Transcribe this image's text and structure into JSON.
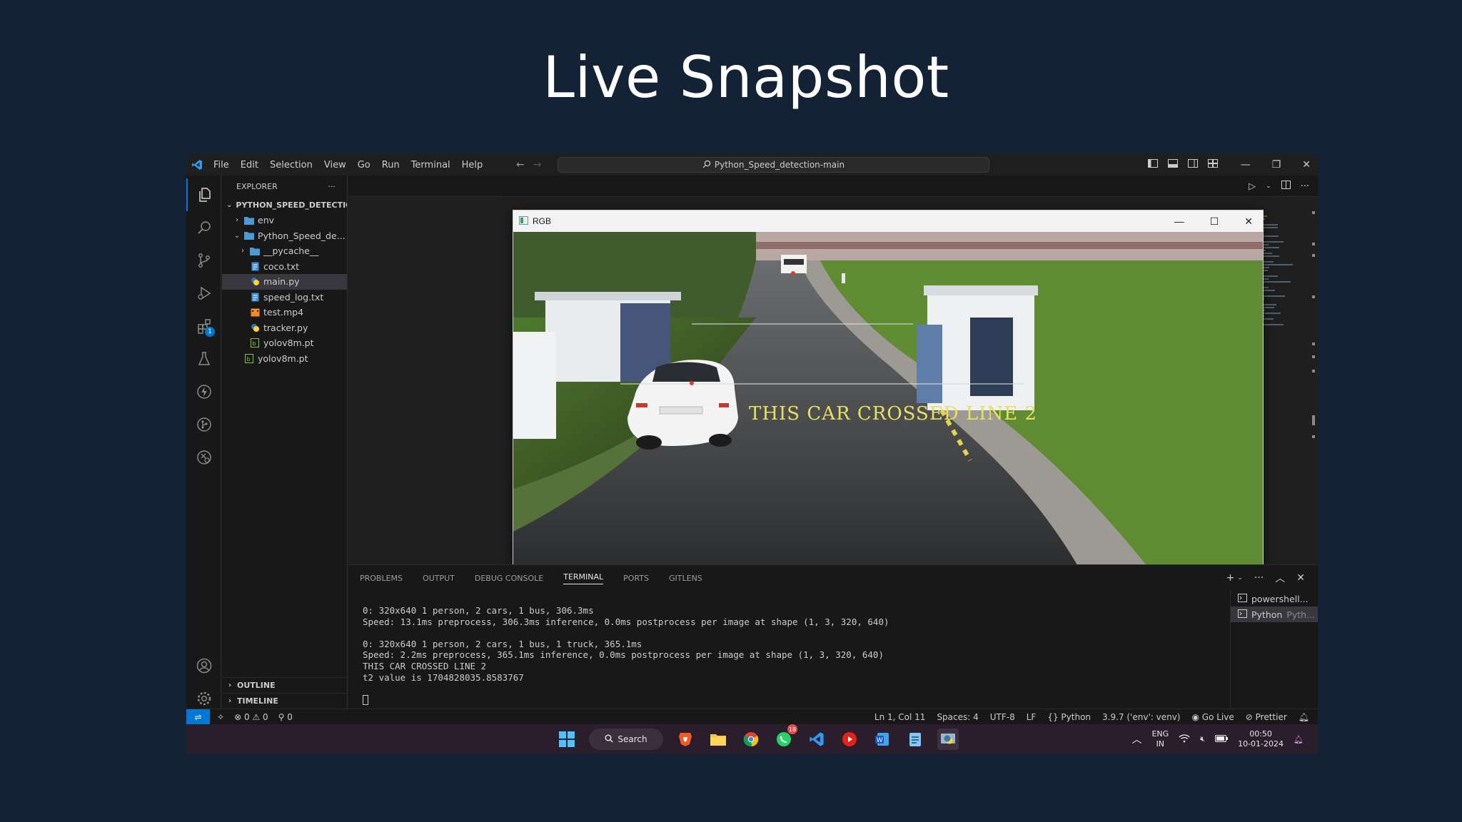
{
  "slide": {
    "title": "Live Snapshot"
  },
  "titlebar": {
    "menu": [
      "File",
      "Edit",
      "Selection",
      "View",
      "Go",
      "Run",
      "Terminal",
      "Help"
    ],
    "search_text": "Python_Speed_detection-main"
  },
  "sidebar": {
    "header": "EXPLORER",
    "project": "PYTHON_SPEED_DETECTIO...",
    "items": [
      {
        "label": "env",
        "type": "folder",
        "depth": 1,
        "expanded": false
      },
      {
        "label": "Python_Speed_de...",
        "type": "folder",
        "depth": 1,
        "expanded": true
      },
      {
        "label": "__pycache__",
        "type": "folder",
        "depth": 2,
        "expanded": false
      },
      {
        "label": "coco.txt",
        "type": "txt",
        "depth": 2
      },
      {
        "label": "main.py",
        "type": "py",
        "depth": 2,
        "selected": true
      },
      {
        "label": "speed_log.txt",
        "type": "txt",
        "depth": 2
      },
      {
        "label": "test.mp4",
        "type": "mp4",
        "depth": 2
      },
      {
        "label": "tracker.py",
        "type": "py",
        "depth": 2
      },
      {
        "label": "yolov8m.pt",
        "type": "pt",
        "depth": 2
      },
      {
        "label": "yolov8m.pt",
        "type": "pt",
        "depth": 1
      }
    ],
    "outline": "OUTLINE",
    "timeline": "TIMELINE",
    "extensions_badge": "1"
  },
  "rgb_window": {
    "title": "RGB",
    "overlay_text": "THIS CAR CROSSED LINE 2"
  },
  "panel": {
    "tabs": [
      "PROBLEMS",
      "OUTPUT",
      "DEBUG CONSOLE",
      "TERMINAL",
      "PORTS",
      "GITLENS"
    ],
    "active_tab": "TERMINAL",
    "terminal_lines": [
      "0: 320x640 1 person, 2 cars, 1 bus, 306.3ms",
      "Speed: 13.1ms preprocess, 306.3ms inference, 0.0ms postprocess per image at shape (1, 3, 320, 640)",
      "",
      "0: 320x640 1 person, 2 cars, 1 bus, 1 truck, 365.1ms",
      "Speed: 2.2ms preprocess, 365.1ms inference, 0.0ms postprocess per image at shape (1, 3, 320, 640)",
      "THIS CAR CROSSED LINE 2",
      "t2 value is 1704828035.8583767"
    ],
    "terminals": [
      {
        "name": "powershell...",
        "sub": ""
      },
      {
        "name": "Python",
        "sub": "Pyth..."
      }
    ]
  },
  "statusbar": {
    "errors": "0",
    "warnings": "0",
    "ports": "0",
    "position": "Ln 1, Col 11",
    "spaces": "Spaces: 4",
    "encoding": "UTF-8",
    "eol": "LF",
    "language": "Python",
    "interpreter": "3.9.7 ('env': venv)",
    "golive": "Go Live",
    "prettier": "Prettier"
  },
  "taskbar": {
    "search": "Search",
    "whatsapp_badge": "18",
    "lang_top": "ENG",
    "lang_bottom": "IN",
    "time": "00:50",
    "date": "10-01-2024"
  }
}
